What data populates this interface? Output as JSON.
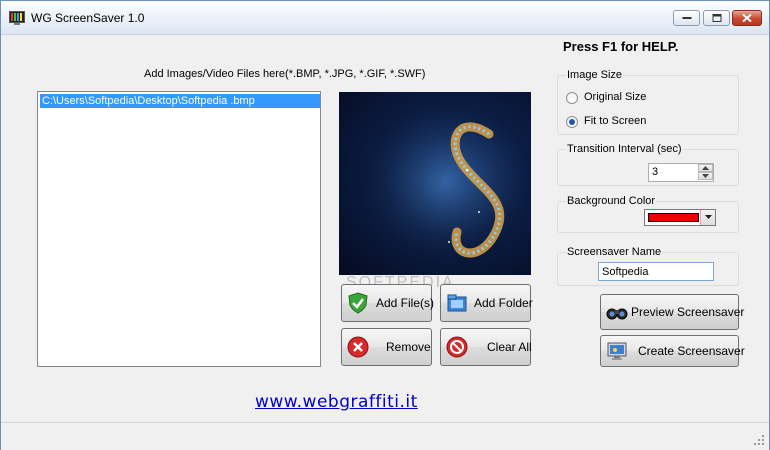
{
  "window": {
    "title": "WG ScreenSaver 1.0",
    "icon": "app-icon"
  },
  "help_text": "Press F1 for HELP.",
  "files": {
    "caption": "Add Images/Video Files here(*.BMP, *.JPG, *.GIF, *.SWF)",
    "items": [
      "C:\\Users\\Softpedia\\Desktop\\Softpedia .bmp"
    ]
  },
  "preview": {
    "watermark": "SOFTPEDIA"
  },
  "buttons": {
    "add_files": "Add File(s)",
    "add_folder": "Add Folder",
    "remove": "Remove",
    "clear_all": "Clear All",
    "preview_screensaver": "Preview Screensaver",
    "create_screensaver": "Create Screensaver"
  },
  "image_size": {
    "label": "Image Size",
    "options": [
      "Original Size",
      "Fit to Screen"
    ],
    "selected": "Fit to Screen"
  },
  "transition": {
    "label": "Transition Interval (sec)",
    "value": "3"
  },
  "background": {
    "label": "Background Color",
    "color": "#ee0000"
  },
  "screensaver_name": {
    "label": "Screensaver Name",
    "value": "Softpedia"
  },
  "link": "www.webgraffiti.it "
}
